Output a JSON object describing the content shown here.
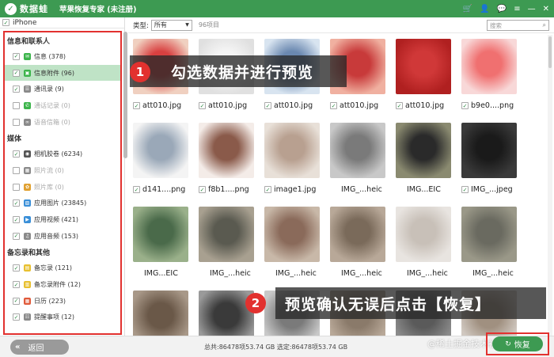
{
  "app": {
    "logo_mark": "✓",
    "logo_text": "数据蛙",
    "title": "苹果恢复专家 (未注册)",
    "icons": [
      "cart-icon",
      "user-icon",
      "chat-icon",
      "menu-icon",
      "minimize-icon",
      "close-icon"
    ],
    "icon_glyphs": [
      "🛒",
      "👤",
      "💬",
      "≡",
      "—",
      "✕"
    ]
  },
  "sidebar": {
    "device": "iPhone",
    "categories": [
      {
        "title": "信息和联系人",
        "items": [
          {
            "label": "信息 (378)",
            "checked": true,
            "color": "#3cb44b",
            "glyph": "✉",
            "selected": false,
            "dim": false
          },
          {
            "label": "信息附件 (96)",
            "checked": true,
            "color": "#3cb44b",
            "glyph": "▣",
            "selected": true,
            "dim": false
          },
          {
            "label": "通讯录 (9)",
            "checked": true,
            "color": "#8a8a8a",
            "glyph": "☰",
            "selected": false,
            "dim": false
          },
          {
            "label": "通话记录 (0)",
            "checked": false,
            "color": "#3cb44b",
            "glyph": "✆",
            "selected": false,
            "dim": true
          },
          {
            "label": "语音信箱 (0)",
            "checked": false,
            "color": "#8a8a8a",
            "glyph": "∞",
            "selected": false,
            "dim": true
          }
        ]
      },
      {
        "title": "媒体",
        "items": [
          {
            "label": "相机胶卷 (6234)",
            "checked": true,
            "color": "#555",
            "glyph": "◉",
            "selected": false,
            "dim": false
          },
          {
            "label": "照片流 (0)",
            "checked": false,
            "color": "#8a8a8a",
            "glyph": "▦",
            "selected": false,
            "dim": true
          },
          {
            "label": "照片库 (0)",
            "checked": false,
            "color": "#e0a030",
            "glyph": "✿",
            "selected": false,
            "dim": true
          },
          {
            "label": "应用图片 (23845)",
            "checked": true,
            "color": "#3a8fd8",
            "glyph": "▨",
            "selected": false,
            "dim": false
          },
          {
            "label": "应用视频 (421)",
            "checked": true,
            "color": "#3a8fd8",
            "glyph": "▶",
            "selected": false,
            "dim": false
          },
          {
            "label": "应用音频 (153)",
            "checked": true,
            "color": "#8a8a8a",
            "glyph": "♫",
            "selected": false,
            "dim": false
          }
        ]
      },
      {
        "title": "备忘录和其他",
        "items": [
          {
            "label": "备忘录 (121)",
            "checked": true,
            "color": "#e8c030",
            "glyph": "▤",
            "selected": false,
            "dim": false
          },
          {
            "label": "备忘录附件 (12)",
            "checked": true,
            "color": "#e8c030",
            "glyph": "▥",
            "selected": false,
            "dim": false
          },
          {
            "label": "日历 (223)",
            "checked": true,
            "color": "#e05a3a",
            "glyph": "▦",
            "selected": false,
            "dim": false
          },
          {
            "label": "提醒事项 (12)",
            "checked": true,
            "color": "#8a8a8a",
            "glyph": "☷",
            "selected": false,
            "dim": false
          }
        ]
      }
    ]
  },
  "filter": {
    "type_label": "类型:",
    "type_value": "所有",
    "count": "96项目",
    "search_placeholder": "搜索"
  },
  "grid": {
    "items": [
      {
        "name": "att010.jpg",
        "checked": true,
        "colors": [
          "#d94040",
          "#f0d0c0"
        ]
      },
      {
        "name": "att010.jpg",
        "checked": true,
        "colors": [
          "#f5f5f5",
          "#e0e0e0"
        ]
      },
      {
        "name": "att010.jpg",
        "checked": true,
        "colors": [
          "#6a88b0",
          "#d8e4f0"
        ]
      },
      {
        "name": "att010.jpg",
        "checked": true,
        "colors": [
          "#c83a3a",
          "#f0b0a0"
        ]
      },
      {
        "name": "att010.jpg",
        "checked": true,
        "colors": [
          "#d03838",
          "#b02020"
        ]
      },
      {
        "name": "b9e0....png",
        "checked": true,
        "colors": [
          "#f07070",
          "#f8d8d8"
        ]
      },
      {
        "name": "d141....png",
        "checked": true,
        "colors": [
          "#9aa8b8",
          "#f4f4f4"
        ]
      },
      {
        "name": "f8b1....png",
        "checked": true,
        "colors": [
          "#8a5a4a",
          "#f4ece8"
        ]
      },
      {
        "name": "image1.jpg",
        "checked": true,
        "colors": [
          "#b8a090",
          "#e8e0d8"
        ]
      },
      {
        "name": "IMG_...heic",
        "checked": false,
        "colors": [
          "#7a7a7a",
          "#c8c8c8"
        ]
      },
      {
        "name": "IMG...EIC",
        "checked": false,
        "colors": [
          "#2a2a2a",
          "#8a8a70"
        ]
      },
      {
        "name": "IMG_...jpeg",
        "checked": true,
        "colors": [
          "#1a1a1a",
          "#3a3a3a"
        ]
      },
      {
        "name": "IMG...EIC",
        "checked": false,
        "colors": [
          "#4a6a4a",
          "#9ab08a"
        ]
      },
      {
        "name": "IMG_...heic",
        "checked": false,
        "colors": [
          "#5a5a50",
          "#a8a090"
        ]
      },
      {
        "name": "IMG_...heic",
        "checked": false,
        "colors": [
          "#8a6a5a",
          "#c8b8a8"
        ]
      },
      {
        "name": "IMG_...heic",
        "checked": false,
        "colors": [
          "#7a6a5a",
          "#b8a898"
        ]
      },
      {
        "name": "IMG_...heic",
        "checked": false,
        "colors": [
          "#c8c0b8",
          "#e8e4e0"
        ]
      },
      {
        "name": "IMG_...heic",
        "checked": false,
        "colors": [
          "#6a6a60",
          "#9a9888"
        ]
      },
      {
        "name": "",
        "checked": false,
        "colors": [
          "#6a5848",
          "#a89888"
        ]
      },
      {
        "name": "",
        "checked": false,
        "colors": [
          "#3a3a3a",
          "#9a9a9a"
        ]
      },
      {
        "name": "",
        "checked": false,
        "colors": [
          "#7a7a7a",
          "#c8c8c8"
        ]
      },
      {
        "name": "",
        "checked": false,
        "colors": [
          "#8a7a6a",
          "#b8a898"
        ]
      },
      {
        "name": "",
        "checked": false,
        "colors": [
          "#5a5a5a",
          "#8a8a8a"
        ]
      },
      {
        "name": "",
        "checked": false,
        "colors": [
          "#a09080",
          "#d0c8c0"
        ]
      }
    ]
  },
  "callouts": [
    {
      "num": "1",
      "text": "勾选数据并进行预览"
    },
    {
      "num": "2",
      "text": "预览确认无误后点击【恢复】"
    }
  ],
  "bottom": {
    "back_label": "返回",
    "status": "总共:86478项53.74 GB 选定:86478项53.74 GB",
    "watermark": "@稀土掘金技术社区",
    "recover_label": "恢复"
  },
  "theme": {
    "accent": "#3d9a52",
    "highlight": "#e2312f",
    "selected_bg": "#bfe3c6"
  }
}
